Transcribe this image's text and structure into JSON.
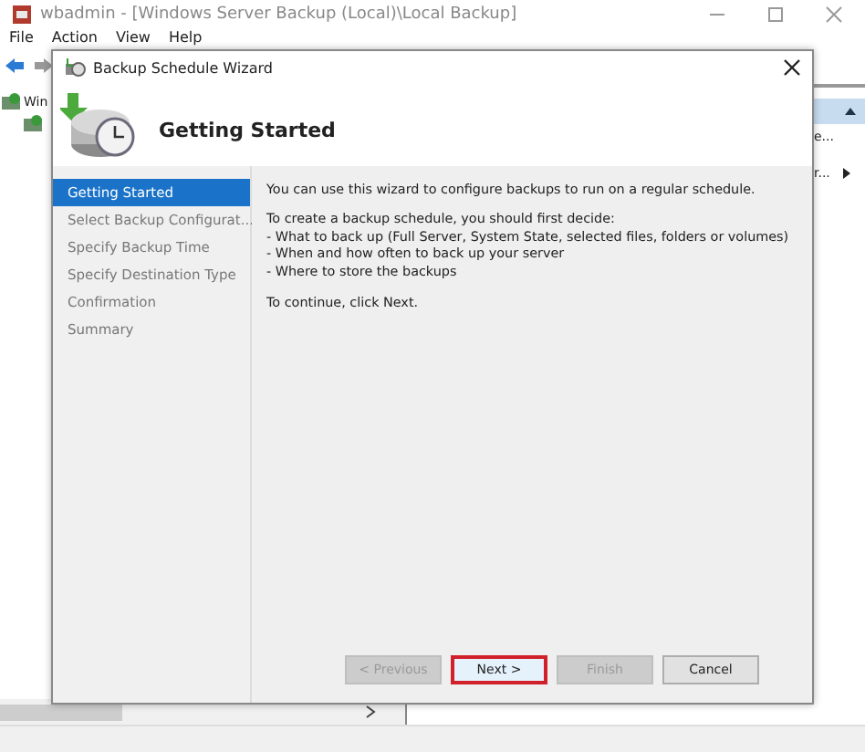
{
  "app": {
    "title": "wbadmin - [Windows Server Backup (Local)\\Local Backup]",
    "menu": [
      "File",
      "Action",
      "View",
      "Help"
    ],
    "tree": [
      {
        "label": "Win"
      }
    ],
    "action_pane": [
      "e...",
      "r..."
    ]
  },
  "dialog": {
    "title": "Backup Schedule Wizard",
    "heading": "Getting Started",
    "steps": [
      {
        "label": "Getting Started",
        "selected": true
      },
      {
        "label": "Select Backup Configurat...",
        "selected": false
      },
      {
        "label": "Specify Backup Time",
        "selected": false
      },
      {
        "label": "Specify Destination Type",
        "selected": false
      },
      {
        "label": "Confirmation",
        "selected": false
      },
      {
        "label": "Summary",
        "selected": false
      }
    ],
    "intro": "You can use this wizard to configure backups to run on a regular schedule.",
    "lead": "To create a backup schedule, you should first decide:",
    "bullets": [
      "-  What to back up (Full Server, System State, selected files, folders or volumes)",
      "-  When and how often to back up your server",
      "-  Where to store the backups"
    ],
    "closing": "To continue, click Next.",
    "buttons": [
      {
        "label": "< Previous",
        "disabled": true,
        "focused": false
      },
      {
        "label": "Next >",
        "disabled": false,
        "focused": true
      },
      {
        "label": "Finish",
        "disabled": true,
        "focused": false
      },
      {
        "label": "Cancel",
        "disabled": false,
        "focused": false
      }
    ]
  }
}
